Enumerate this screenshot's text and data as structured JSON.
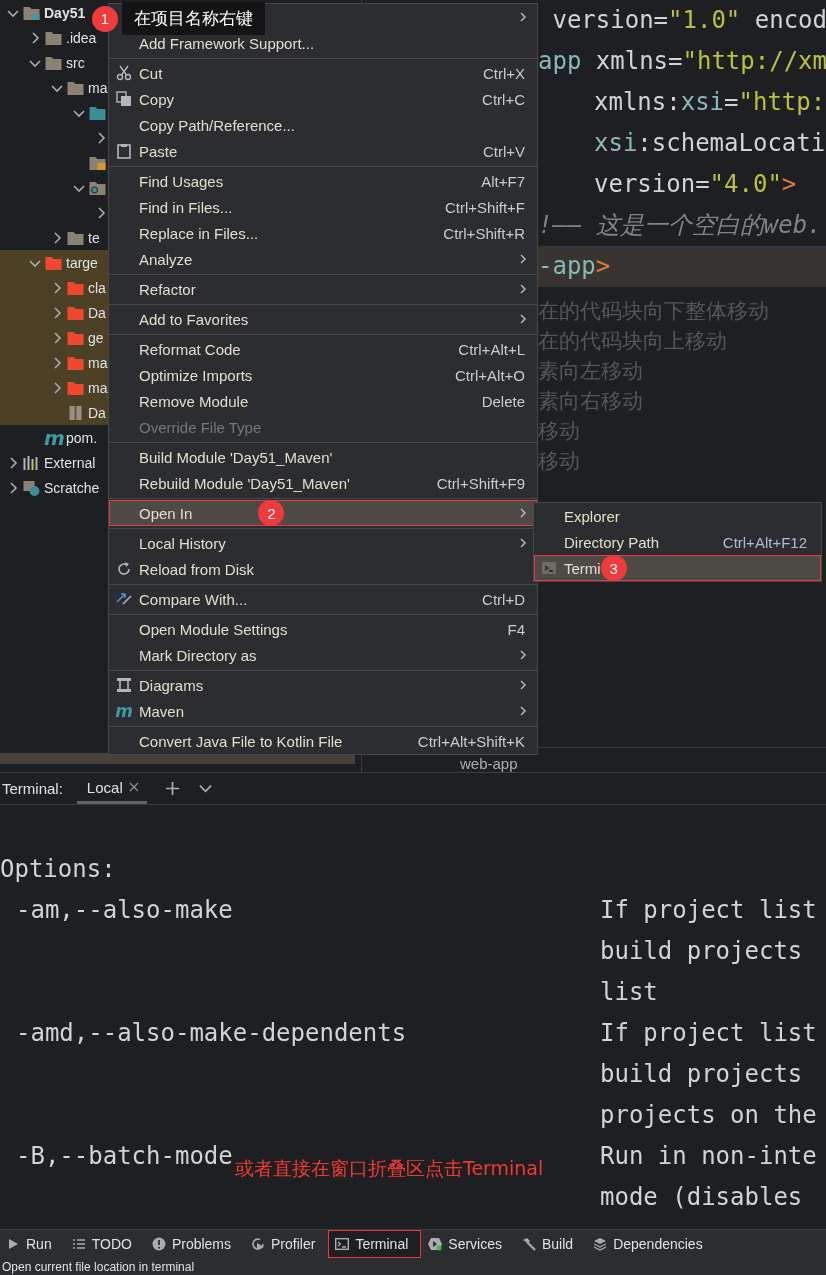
{
  "callout": {
    "badge": "1",
    "text": "在项目名称右键"
  },
  "project_tree": [
    {
      "label": "Day51",
      "kind": "module",
      "expanded": true,
      "children": [
        {
          "label": ".idea",
          "kind": "folder",
          "expanded": false
        },
        {
          "label": "src",
          "kind": "folder",
          "expanded": true,
          "children": [
            {
              "label": "ma",
              "kind": "folder",
              "expanded": true,
              "children": [
                {
                  "kind": "source-folder",
                  "expanded": true,
                  "children": [
                    {
                      "expanded": false
                    }
                  ]
                },
                {
                  "kind": "resources-folder"
                },
                {
                  "kind": "web-folder",
                  "expanded": true,
                  "children": [
                    {
                      "expanded": false
                    }
                  ]
                }
              ]
            },
            {
              "label": "te",
              "kind": "folder",
              "expanded": false
            }
          ]
        },
        {
          "label": "targe",
          "kind": "excluded-folder",
          "expanded": true,
          "excluded": true,
          "children": [
            {
              "label": "cla",
              "kind": "excluded-folder",
              "expanded": false
            },
            {
              "label": "Da",
              "kind": "excluded-folder",
              "expanded": false
            },
            {
              "label": "ge",
              "kind": "excluded-folder",
              "expanded": false
            },
            {
              "label": "ma",
              "kind": "excluded-folder",
              "expanded": false
            },
            {
              "label": "ma",
              "kind": "excluded-folder",
              "expanded": false
            },
            {
              "label": "Da",
              "kind": "archive"
            }
          ]
        },
        {
          "label": "pom.",
          "kind": "maven-file",
          "glyph": "m"
        }
      ]
    },
    {
      "label": "External",
      "kind": "libraries",
      "expanded": false
    },
    {
      "label": "Scratche",
      "kind": "scratches",
      "expanded": false
    }
  ],
  "editor": {
    "lines": [
      {
        "indent": false,
        "highlighted": false,
        "tokens": [
          {
            "t": " version=",
            "kind": "plain"
          },
          {
            "t": "\"1.0\"",
            "kind": "str"
          },
          {
            "t": " encod",
            "kind": "plain"
          }
        ]
      },
      {
        "indent": false,
        "highlighted": false,
        "tokens": [
          {
            "t": "app",
            "kind": "tag"
          },
          {
            "t": " xmlns=",
            "kind": "plain"
          },
          {
            "t": "\"http://xm",
            "kind": "str"
          }
        ]
      },
      {
        "indent": true,
        "highlighted": false,
        "tokens": [
          {
            "t": "xmlns:",
            "kind": "plain"
          },
          {
            "t": "xsi",
            "kind": "tag"
          },
          {
            "t": "=",
            "kind": "plain"
          },
          {
            "t": "\"http:",
            "kind": "str"
          }
        ]
      },
      {
        "indent": true,
        "highlighted": false,
        "tokens": [
          {
            "t": "xsi",
            "kind": "tag"
          },
          {
            "t": ":schemaLocati",
            "kind": "plain"
          }
        ]
      },
      {
        "indent": true,
        "highlighted": false,
        "tokens": [
          {
            "t": "version=",
            "kind": "plain"
          },
          {
            "t": "\"4.0\"",
            "kind": "str"
          },
          {
            "t": ">",
            "kind": "bracket"
          }
        ]
      },
      {
        "indent": false,
        "highlighted": false,
        "tokens": [
          {
            "t": "!—— 这是一个空白的web.",
            "kind": "comment"
          }
        ]
      },
      {
        "indent": false,
        "highlighted": true,
        "tokens": [
          {
            "t": "-app",
            "kind": "tag"
          },
          {
            "t": ">",
            "kind": "bracket"
          }
        ]
      }
    ],
    "hints": [
      "在的代码块向下整体移动",
      "在的代码块向上移动",
      "素向左移动",
      "素向右移动",
      "移动",
      "移动"
    ],
    "breadcrumb": "web-app"
  },
  "context_menu": {
    "groups": [
      [
        {
          "submenu": true,
          "selected": false,
          "disabled": false
        },
        {
          "label": "Add Framework Support...",
          "submenu": false,
          "selected": false,
          "disabled": false
        }
      ],
      [
        {
          "label": "Cut",
          "kind": "cut",
          "shortcut": "Ctrl+X",
          "submenu": false,
          "selected": false,
          "disabled": false
        },
        {
          "label": "Copy",
          "kind": "copy",
          "shortcut": "Ctrl+C",
          "submenu": false,
          "selected": false,
          "disabled": false
        },
        {
          "label": "Copy Path/Reference...",
          "submenu": false,
          "selected": false,
          "disabled": false
        },
        {
          "label": "Paste",
          "kind": "paste",
          "shortcut": "Ctrl+V",
          "submenu": false,
          "selected": false,
          "disabled": false
        }
      ],
      [
        {
          "label": "Find Usages",
          "shortcut": "Alt+F7",
          "submenu": false,
          "selected": false,
          "disabled": false
        },
        {
          "label": "Find in Files...",
          "shortcut": "Ctrl+Shift+F",
          "submenu": false,
          "selected": false,
          "disabled": false
        },
        {
          "label": "Replace in Files...",
          "shortcut": "Ctrl+Shift+R",
          "submenu": false,
          "selected": false,
          "disabled": false
        },
        {
          "label": "Analyze",
          "submenu": true,
          "selected": false,
          "disabled": false
        }
      ],
      [
        {
          "label": "Refactor",
          "submenu": true,
          "selected": false,
          "disabled": false
        }
      ],
      [
        {
          "label": "Add to Favorites",
          "submenu": true,
          "selected": false,
          "disabled": false
        }
      ],
      [
        {
          "label": "Reformat Code",
          "shortcut": "Ctrl+Alt+L",
          "submenu": false,
          "selected": false,
          "disabled": false
        },
        {
          "label": "Optimize Imports",
          "shortcut": "Ctrl+Alt+O",
          "submenu": false,
          "selected": false,
          "disabled": false
        },
        {
          "label": "Remove Module",
          "shortcut": "Delete",
          "submenu": false,
          "selected": false,
          "disabled": false
        },
        {
          "label": "Override File Type",
          "submenu": false,
          "selected": false,
          "disabled": true
        }
      ],
      [
        {
          "label": "Build Module 'Day51_Maven'",
          "submenu": false,
          "selected": false,
          "disabled": false
        },
        {
          "label": "Rebuild Module 'Day51_Maven'",
          "shortcut": "Ctrl+Shift+F9",
          "submenu": false,
          "selected": false,
          "disabled": false
        }
      ],
      [
        {
          "label": "Open In",
          "submenu": true,
          "selected": true,
          "disabled": false,
          "badge": "2"
        }
      ],
      [
        {
          "label": "Local History",
          "submenu": true,
          "selected": false,
          "disabled": false
        },
        {
          "label": "Reload from Disk",
          "kind": "reload",
          "submenu": false,
          "selected": false,
          "disabled": false
        }
      ],
      [
        {
          "label": "Compare With...",
          "kind": "compare",
          "shortcut": "Ctrl+D",
          "submenu": false,
          "selected": false,
          "disabled": false
        }
      ],
      [
        {
          "label": "Open Module Settings",
          "shortcut": "F4",
          "submenu": false,
          "selected": false,
          "disabled": false
        },
        {
          "label": "Mark Directory as",
          "submenu": true,
          "selected": false,
          "disabled": false
        }
      ],
      [
        {
          "label": "Diagrams",
          "kind": "diagram",
          "submenu": true,
          "selected": false,
          "disabled": false
        },
        {
          "label": "Maven",
          "kind": "maven",
          "glyph": "m",
          "submenu": true,
          "selected": false,
          "disabled": false
        }
      ],
      [
        {
          "label": "Convert Java File to Kotlin File",
          "shortcut": "Ctrl+Alt+Shift+K",
          "submenu": false,
          "selected": false,
          "disabled": false
        }
      ]
    ]
  },
  "submenu": {
    "items": [
      {
        "label": "Explorer",
        "selected": false
      },
      {
        "label": "Directory Path",
        "shortcut": "Ctrl+Alt+F12",
        "selected": false
      },
      {
        "label": "Termi",
        "kind": "terminal",
        "selected": true,
        "badge": "3"
      }
    ]
  },
  "terminal": {
    "title": "Terminal:",
    "tabs": [
      {
        "label": "Local",
        "selected": true
      }
    ],
    "rows": [
      {
        "kind": "heading",
        "option": "Options:"
      },
      {
        "kind": "option",
        "option": "-am,--also-make",
        "description": "If project list"
      },
      {
        "kind": "continuation",
        "description": "build projects"
      },
      {
        "kind": "continuation",
        "description": "list"
      },
      {
        "kind": "option",
        "option": "-amd,--also-make-dependents",
        "description": "If project list"
      },
      {
        "kind": "continuation",
        "description": "build projects"
      },
      {
        "kind": "continuation",
        "description": "projects on the"
      },
      {
        "kind": "option",
        "option": "-B,--batch-mode",
        "description": "Run in non-inte"
      },
      {
        "kind": "continuation",
        "description": "mode (disables"
      }
    ],
    "annotation": "或者直接在窗口折叠区点击Terminal"
  },
  "tool_windows": [
    {
      "label": "Run",
      "kind": "run",
      "selected": false,
      "annotated": false
    },
    {
      "label": "TODO",
      "kind": "list",
      "selected": false,
      "annotated": false
    },
    {
      "label": "Problems",
      "kind": "problems",
      "selected": false,
      "annotated": false
    },
    {
      "label": "Profiler",
      "kind": "profiler",
      "selected": false,
      "annotated": false
    },
    {
      "label": "Terminal",
      "kind": "terminal",
      "selected": true,
      "annotated": true
    },
    {
      "label": "Services",
      "kind": "services",
      "selected": false,
      "annotated": false
    },
    {
      "label": "Build",
      "kind": "build",
      "selected": false,
      "annotated": false
    },
    {
      "label": "Dependencies",
      "kind": "layers",
      "selected": false,
      "annotated": false
    }
  ],
  "status_bar": {
    "text": "Open current file location in terminal"
  }
}
